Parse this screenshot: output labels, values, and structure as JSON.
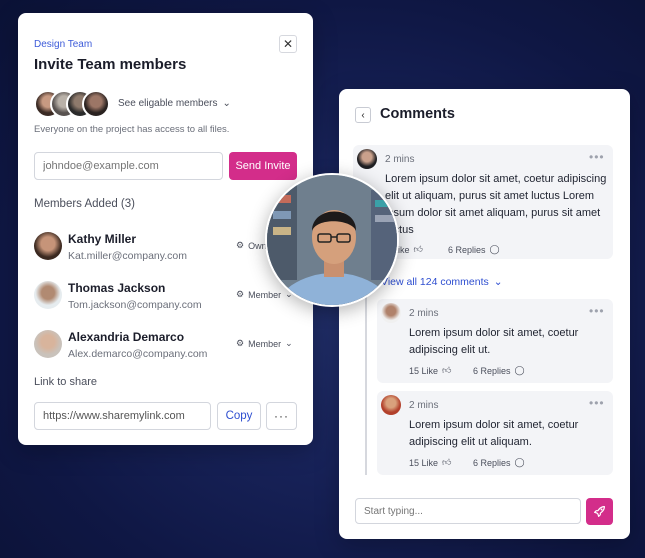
{
  "invite_card": {
    "team_label": "Design Team",
    "title": "Invite Team members",
    "close_icon": "close-icon",
    "eligible_label": "See eligable members",
    "access_note": "Everyone on the project has access to all files.",
    "email_placeholder": "johndoe@example.com",
    "send_label": "Send Invite",
    "members_added_label": "Members Added (3)",
    "members": [
      {
        "name": "Kathy Miller",
        "email": "Kat.miller@company.com",
        "role": "Owner"
      },
      {
        "name": "Thomas Jackson",
        "email": "Tom.jackson@company.com",
        "role": "Member"
      },
      {
        "name": "Alexandria Demarco",
        "email": "Alex.demarco@company.com",
        "role": "Member"
      }
    ],
    "link_label": "Link to share",
    "link_value": "https://www.sharemylink.com",
    "copy_label": "Copy",
    "more_label": "···"
  },
  "comments_card": {
    "title": "Comments",
    "main_comment": {
      "time": "2 mins",
      "text": "Lorem ipsum dolor sit amet, coetur adipiscing elit ut aliquam, purus sit amet luctus Lorem ipsum dolor sit amet aliquam, purus sit amet luctus",
      "like": "Like",
      "replies": "6 Replies"
    },
    "view_all": "View all 124 comments",
    "replies": [
      {
        "time": "2 mins",
        "text": "Lorem ipsum dolor sit amet, coetur adipiscing elit ut.",
        "likes": "15 Like",
        "replies": "6 Replies"
      },
      {
        "time": "2 mins",
        "text": "Lorem ipsum dolor sit amet, coetur adipiscing elit ut aliquam.",
        "likes": "15 Like",
        "replies": "6 Replies"
      }
    ],
    "input_placeholder": "Start typing..."
  },
  "colors": {
    "accent": "#d32d8a",
    "link": "#2f4fd0",
    "background": "#131b4d"
  }
}
